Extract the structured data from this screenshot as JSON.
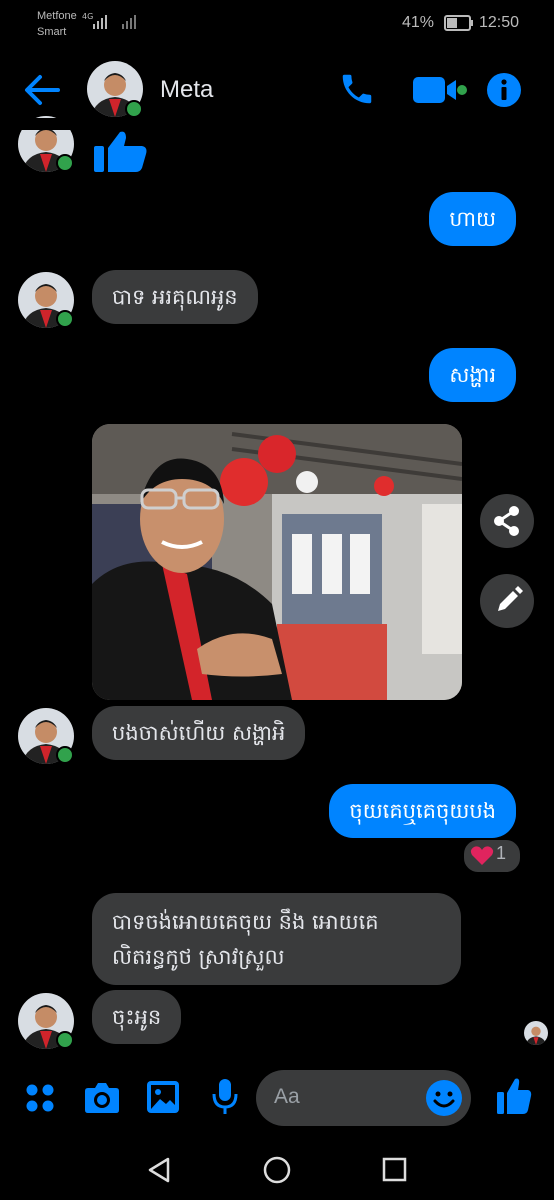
{
  "status_bar": {
    "carrier_line1": "Metfone",
    "carrier_line2": "Smart",
    "network": "4G",
    "battery": "41%",
    "time": "12:50"
  },
  "header": {
    "contact_name": "Meta",
    "icons": [
      "back-arrow-icon",
      "phone-icon",
      "video-camera-icon",
      "info-icon"
    ]
  },
  "messages": [
    {
      "from": "contact",
      "type": "like",
      "icon": "thumbs-up-icon"
    },
    {
      "from": "me",
      "text": "ហាយ"
    },
    {
      "from": "contact",
      "text": "បាទ អរគុណអូន"
    },
    {
      "from": "me",
      "text": "សង្ហារ"
    },
    {
      "from": "contact",
      "type": "photo"
    },
    {
      "from": "contact",
      "text": "បងចាស់ហើយ សង្ហាអិ"
    },
    {
      "from": "me",
      "text": "ចុយគេឬគេចុយបង",
      "reaction": {
        "emoji": "heart-icon",
        "count": "1"
      }
    },
    {
      "from": "contact",
      "text_line1": "បាទចង់អោយគេចុយ នឹង អោយគេ",
      "text_line2": "លិតរន្ធកូថ ស្រាវស្រួល"
    },
    {
      "from": "contact",
      "text": "ចុះអូន"
    }
  ],
  "composer": {
    "placeholder": "Aa",
    "icons": [
      "apps-icon",
      "camera-icon",
      "gallery-icon",
      "microphone-icon",
      "emoji-icon",
      "thumbs-up-icon"
    ]
  },
  "colors": {
    "accent": "#0084ff",
    "incoming_bubble": "#3a3b3c",
    "online": "#31a24c",
    "heart": "#e0245e"
  }
}
